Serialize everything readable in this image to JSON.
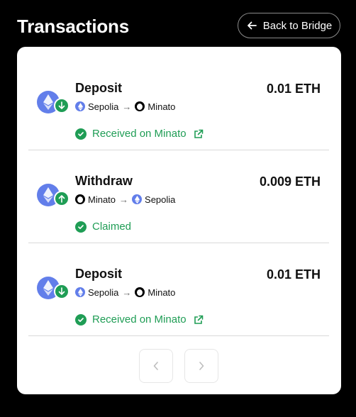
{
  "header": {
    "title": "Transactions",
    "back_label": "Back to Bridge"
  },
  "colors": {
    "eth": "#627eea",
    "success": "#1f9d55",
    "background": "#000000",
    "card": "#ffffff"
  },
  "transactions": [
    {
      "type": "Deposit",
      "amount": "0.01 ETH",
      "direction": "arrow-down-icon",
      "from": "Sepolia",
      "to": "Minato",
      "status": "Received on Minato",
      "has_link": true
    },
    {
      "type": "Withdraw",
      "amount": "0.009 ETH",
      "direction": "arrow-up-icon",
      "from": "Minato",
      "to": "Sepolia",
      "status": "Claimed",
      "has_link": false
    },
    {
      "type": "Deposit",
      "amount": "0.01 ETH",
      "direction": "arrow-down-icon",
      "from": "Sepolia",
      "to": "Minato",
      "status": "Received on Minato",
      "has_link": true
    }
  ],
  "pagination": {
    "prev_icon": "chevron-left-icon",
    "next_icon": "chevron-right-icon"
  }
}
